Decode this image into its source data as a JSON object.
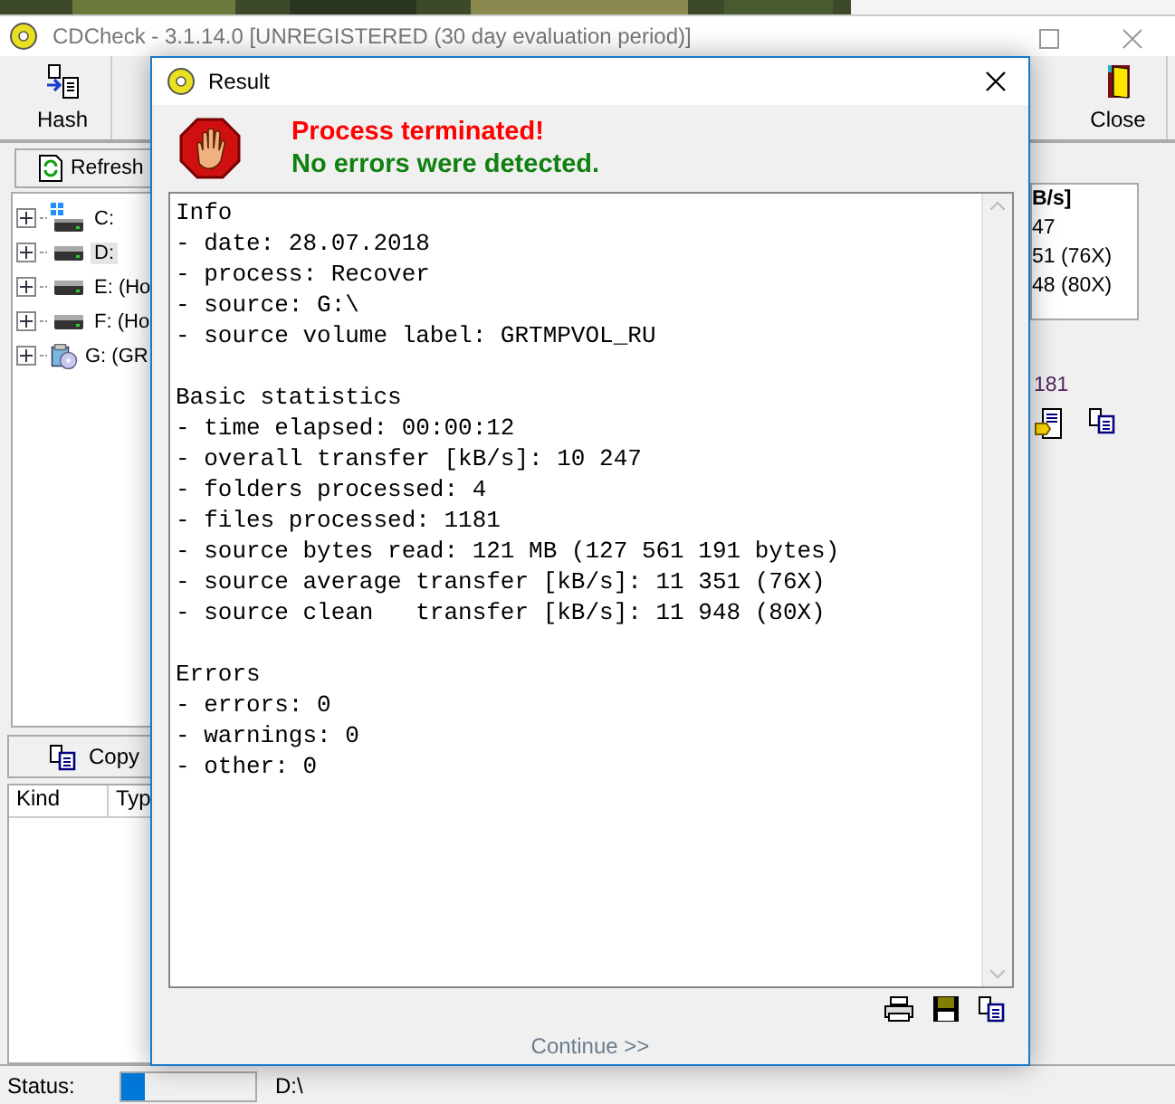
{
  "main_window": {
    "title": "CDCheck - 3.1.14.0 [UNREGISTERED (30 day evaluation period)]",
    "toolbar": [
      {
        "label": "Hash",
        "kind": "hash"
      },
      {
        "label": "Close",
        "kind": "close"
      }
    ],
    "refresh_button": "Refresh",
    "drives": [
      {
        "label": "C:",
        "kind": "system",
        "selected": false
      },
      {
        "label": "D:",
        "kind": "disk",
        "selected": true
      },
      {
        "label": "E: (Ho",
        "kind": "disk",
        "selected": false
      },
      {
        "label": "F: (Ho",
        "kind": "disk",
        "selected": false
      },
      {
        "label": "G: (GR",
        "kind": "cd",
        "selected": false
      }
    ],
    "copy_button": "Copy",
    "list_columns": [
      "Kind",
      "Typ"
    ],
    "right_panel": {
      "lines": [
        "B/s]",
        "47",
        "51 (76X)",
        "48 (80X)"
      ],
      "count": "181"
    },
    "status": {
      "label": "Status:",
      "level": 0.18,
      "path": "D:\\"
    }
  },
  "dialog": {
    "title": "Result",
    "message": "Process terminated!",
    "result": "No errors were detected.",
    "sections": [
      {
        "heading": "Info",
        "lines": [
          "- date: 28.07.2018",
          "- process: Recover",
          "- source: G:\\",
          "- source volume label: GRTMPVOL_RU"
        ]
      },
      {
        "heading": "Basic statistics",
        "lines": [
          "- time elapsed: 00:00:12",
          "- overall transfer [kB/s]: 10 247",
          "- folders processed: 4",
          "- files processed: 1181",
          "- source bytes read: 121 MB (127 561 191 bytes)",
          "- source average transfer [kB/s]: 11 351 (76X)",
          "- source clean   transfer [kB/s]: 11 948 (80X)"
        ]
      },
      {
        "heading": "Errors",
        "lines": [
          "- errors: 0",
          "- warnings: 0",
          "- other: 0"
        ]
      }
    ],
    "continue_button": "Continue >>"
  }
}
